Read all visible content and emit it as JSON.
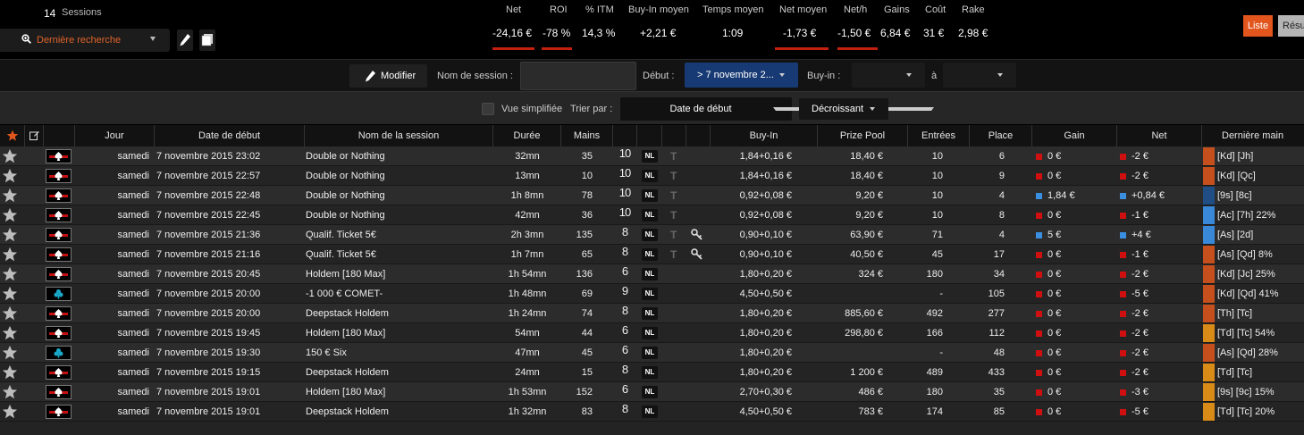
{
  "header": {
    "sessions_count": "14",
    "sessions_label": "Sessions",
    "search_label": "Dernière recherche",
    "btn_liste": "Liste",
    "btn_resume": "Résumé"
  },
  "stats": [
    {
      "label": "Net",
      "value": "-24,16 €",
      "negative": true
    },
    {
      "label": "ROI",
      "value": "-78 %",
      "negative": true
    },
    {
      "label": "% ITM",
      "value": "14,3 %",
      "negative": false
    },
    {
      "label": "Buy-In moyen",
      "value": "+2,21 €",
      "negative": false
    },
    {
      "label": "Temps moyen",
      "value": "1:09",
      "negative": false
    },
    {
      "label": "Net moyen",
      "value": "-1,73 €",
      "negative": true
    },
    {
      "label": "Net/h",
      "value": "-1,50 €",
      "negative": true
    },
    {
      "label": "Gains",
      "value": "6,84 €",
      "negative": false
    },
    {
      "label": "Coût",
      "value": "31 €",
      "negative": false
    },
    {
      "label": "Rake",
      "value": "2,98 €",
      "negative": false
    }
  ],
  "filter": {
    "modifier_label": "Modifier",
    "session_name_label": "Nom de session :",
    "session_name_value": "",
    "debut_label": "Début :",
    "debut_value": "> 7 novembre 2...",
    "buyin_label": "Buy-in :",
    "buyin_to": "à"
  },
  "options": {
    "vue_label": "Vue simplifiée",
    "sort_label": "Trier par :",
    "sort_value": "Date de début",
    "order_value": "Décroissant"
  },
  "columns": [
    "Jour",
    "Date de début",
    "Nom de la session",
    "Durée",
    "Mains",
    "Buy-In",
    "Prize Pool",
    "Entrées",
    "Place",
    "Gain",
    "Net",
    "Dernière main"
  ],
  "colors": {
    "accent": "#e2561e",
    "loss": "#d01010",
    "win": "#3b8fe0",
    "hand_orange": "#c5501e",
    "hand_gold": "#d98b18",
    "hand_blue": "#3a88d8",
    "hand_navy": "#1f4d84"
  },
  "rows": [
    {
      "room": "spade-red",
      "jour": "samedi",
      "date": "7 novembre 2015 23:02",
      "name": "Double or Nothing",
      "duree": "32mn",
      "mains": "35",
      "size": "10",
      "game": "NL",
      "t": true,
      "key": false,
      "buyin": "1,84+0,16 €",
      "pool": "18,40 €",
      "entrees": "10",
      "place": "6",
      "gain": "0 €",
      "gain_win": false,
      "net": "-2 €",
      "net_win": false,
      "hand_color": "orange",
      "hand": "[Kd] [Jh]"
    },
    {
      "room": "spade-red",
      "jour": "samedi",
      "date": "7 novembre 2015 22:57",
      "name": "Double or Nothing",
      "duree": "13mn",
      "mains": "10",
      "size": "10",
      "game": "NL",
      "t": true,
      "key": false,
      "buyin": "1,84+0,16 €",
      "pool": "18,40 €",
      "entrees": "10",
      "place": "9",
      "gain": "0 €",
      "gain_win": false,
      "net": "-2 €",
      "net_win": false,
      "hand_color": "orange",
      "hand": "[Kd] [Qc]"
    },
    {
      "room": "spade-red",
      "jour": "samedi",
      "date": "7 novembre 2015 22:48",
      "name": "Double or Nothing",
      "duree": "1h 8mn",
      "mains": "78",
      "size": "10",
      "game": "NL",
      "t": true,
      "key": false,
      "buyin": "0,92+0,08 €",
      "pool": "9,20 €",
      "entrees": "10",
      "place": "4",
      "gain": "1,84 €",
      "gain_win": true,
      "net": "+0,84 €",
      "net_win": true,
      "hand_color": "navy",
      "hand": "[9s] [8c]"
    },
    {
      "room": "spade-red",
      "jour": "samedi",
      "date": "7 novembre 2015 22:45",
      "name": "Double or Nothing",
      "duree": "42mn",
      "mains": "36",
      "size": "10",
      "game": "NL",
      "t": true,
      "key": false,
      "buyin": "0,92+0,08 €",
      "pool": "9,20 €",
      "entrees": "10",
      "place": "8",
      "gain": "0 €",
      "gain_win": false,
      "net": "-1 €",
      "net_win": false,
      "hand_color": "blue",
      "hand": "[Ac] [7h]  22%"
    },
    {
      "room": "spade-red",
      "jour": "samedi",
      "date": "7 novembre 2015 21:36",
      "name": "Qualif. Ticket 5€",
      "duree": "2h 3mn",
      "mains": "135",
      "size": "8",
      "game": "NL",
      "t": true,
      "key": true,
      "buyin": "0,90+0,10 €",
      "pool": "63,90 €",
      "entrees": "71",
      "place": "4",
      "gain": "5 €",
      "gain_win": true,
      "net": "+4 €",
      "net_win": true,
      "hand_color": "blue",
      "hand": "[As] [2d]"
    },
    {
      "room": "spade-red",
      "jour": "samedi",
      "date": "7 novembre 2015 21:16",
      "name": "Qualif. Ticket 5€",
      "duree": "1h 7mn",
      "mains": "65",
      "size": "8",
      "game": "NL",
      "t": true,
      "key": true,
      "buyin": "0,90+0,10 €",
      "pool": "40,50 €",
      "entrees": "45",
      "place": "17",
      "gain": "0 €",
      "gain_win": false,
      "net": "-1 €",
      "net_win": false,
      "hand_color": "orange",
      "hand": "[As] [Qd]  8%"
    },
    {
      "room": "spade-red",
      "jour": "samedi",
      "date": "7 novembre 2015 20:45",
      "name": "Holdem [180 Max]",
      "duree": "1h 54mn",
      "mains": "136",
      "size": "6",
      "game": "NL",
      "t": false,
      "key": false,
      "buyin": "1,80+0,20 €",
      "pool": "324 €",
      "entrees": "180",
      "place": "34",
      "gain": "0 €",
      "gain_win": false,
      "net": "-2 €",
      "net_win": false,
      "hand_color": "orange",
      "hand": "[Kd] [Jc]  25%"
    },
    {
      "room": "club-blue",
      "jour": "samedi",
      "date": "7 novembre 2015 20:00",
      "name": "-1 000 € COMET-",
      "duree": "1h 48mn",
      "mains": "69",
      "size": "9",
      "game": "NL",
      "t": false,
      "key": false,
      "buyin": "4,50+0,50 €",
      "pool": "",
      "entrees": "-",
      "place": "105",
      "gain": "0 €",
      "gain_win": false,
      "net": "-5 €",
      "net_win": false,
      "hand_color": "orange",
      "hand": "[Kd] [Qd]  41%"
    },
    {
      "room": "spade-red",
      "jour": "samedi",
      "date": "7 novembre 2015 20:00",
      "name": "Deepstack Holdem",
      "duree": "1h 24mn",
      "mains": "74",
      "size": "8",
      "game": "NL",
      "t": false,
      "key": false,
      "buyin": "1,80+0,20 €",
      "pool": "885,60 €",
      "entrees": "492",
      "place": "277",
      "gain": "0 €",
      "gain_win": false,
      "net": "-2 €",
      "net_win": false,
      "hand_color": "orange",
      "hand": "[Th] [Tc]"
    },
    {
      "room": "spade-red",
      "jour": "samedi",
      "date": "7 novembre 2015 19:45",
      "name": "Holdem [180 Max]",
      "duree": "54mn",
      "mains": "44",
      "size": "6",
      "game": "NL",
      "t": false,
      "key": false,
      "buyin": "1,80+0,20 €",
      "pool": "298,80 €",
      "entrees": "166",
      "place": "112",
      "gain": "0 €",
      "gain_win": false,
      "net": "-2 €",
      "net_win": false,
      "hand_color": "gold",
      "hand": "[Td] [Tc]  54%"
    },
    {
      "room": "club-blue",
      "jour": "samedi",
      "date": "7 novembre 2015 19:30",
      "name": "150 € Six",
      "duree": "47mn",
      "mains": "45",
      "size": "6",
      "game": "NL",
      "t": false,
      "key": false,
      "buyin": "1,80+0,20 €",
      "pool": "",
      "entrees": "-",
      "place": "48",
      "gain": "0 €",
      "gain_win": false,
      "net": "-2 €",
      "net_win": false,
      "hand_color": "orange",
      "hand": "[As] [Qd]  28%"
    },
    {
      "room": "spade-red",
      "jour": "samedi",
      "date": "7 novembre 2015 19:15",
      "name": "Deepstack Holdem",
      "duree": "24mn",
      "mains": "15",
      "size": "8",
      "game": "NL",
      "t": false,
      "key": false,
      "buyin": "1,80+0,20 €",
      "pool": "1 200 €",
      "entrees": "489",
      "place": "433",
      "gain": "0 €",
      "gain_win": false,
      "net": "-2 €",
      "net_win": false,
      "hand_color": "gold",
      "hand": "[Td] [Tc]"
    },
    {
      "room": "spade-red",
      "jour": "samedi",
      "date": "7 novembre 2015 19:01",
      "name": "Holdem [180 Max]",
      "duree": "1h 53mn",
      "mains": "152",
      "size": "6",
      "game": "NL",
      "t": false,
      "key": false,
      "buyin": "2,70+0,30 €",
      "pool": "486 €",
      "entrees": "180",
      "place": "35",
      "gain": "0 €",
      "gain_win": false,
      "net": "-3 €",
      "net_win": false,
      "hand_color": "gold",
      "hand": "[9s] [9c]  15%"
    },
    {
      "room": "spade-red",
      "jour": "samedi",
      "date": "7 novembre 2015 19:01",
      "name": "Deepstack Holdem",
      "duree": "1h 32mn",
      "mains": "83",
      "size": "8",
      "game": "NL",
      "t": false,
      "key": false,
      "buyin": "4,50+0,50 €",
      "pool": "783 €",
      "entrees": "174",
      "place": "85",
      "gain": "0 €",
      "gain_win": false,
      "net": "-5 €",
      "net_win": false,
      "hand_color": "gold",
      "hand": "[Td] [Tc]  20%"
    }
  ]
}
